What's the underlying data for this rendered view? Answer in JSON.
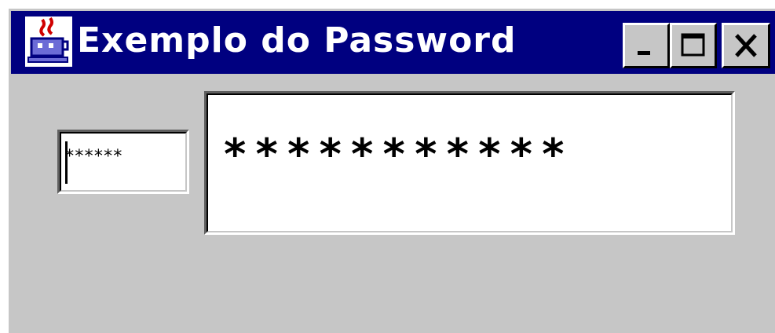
{
  "window": {
    "title": "Exemplo do Password",
    "icon": "java-coffee-cup-icon",
    "controls": {
      "minimize_icon": "minimize-icon",
      "maximize_icon": "maximize-icon",
      "close_icon": "close-icon"
    }
  },
  "password_field": {
    "masked_value": "******"
  },
  "display_field": {
    "text": "***********"
  },
  "colors": {
    "titlebar": "#000080",
    "window_background": "#c6c6c6",
    "field_background": "#ffffff"
  }
}
